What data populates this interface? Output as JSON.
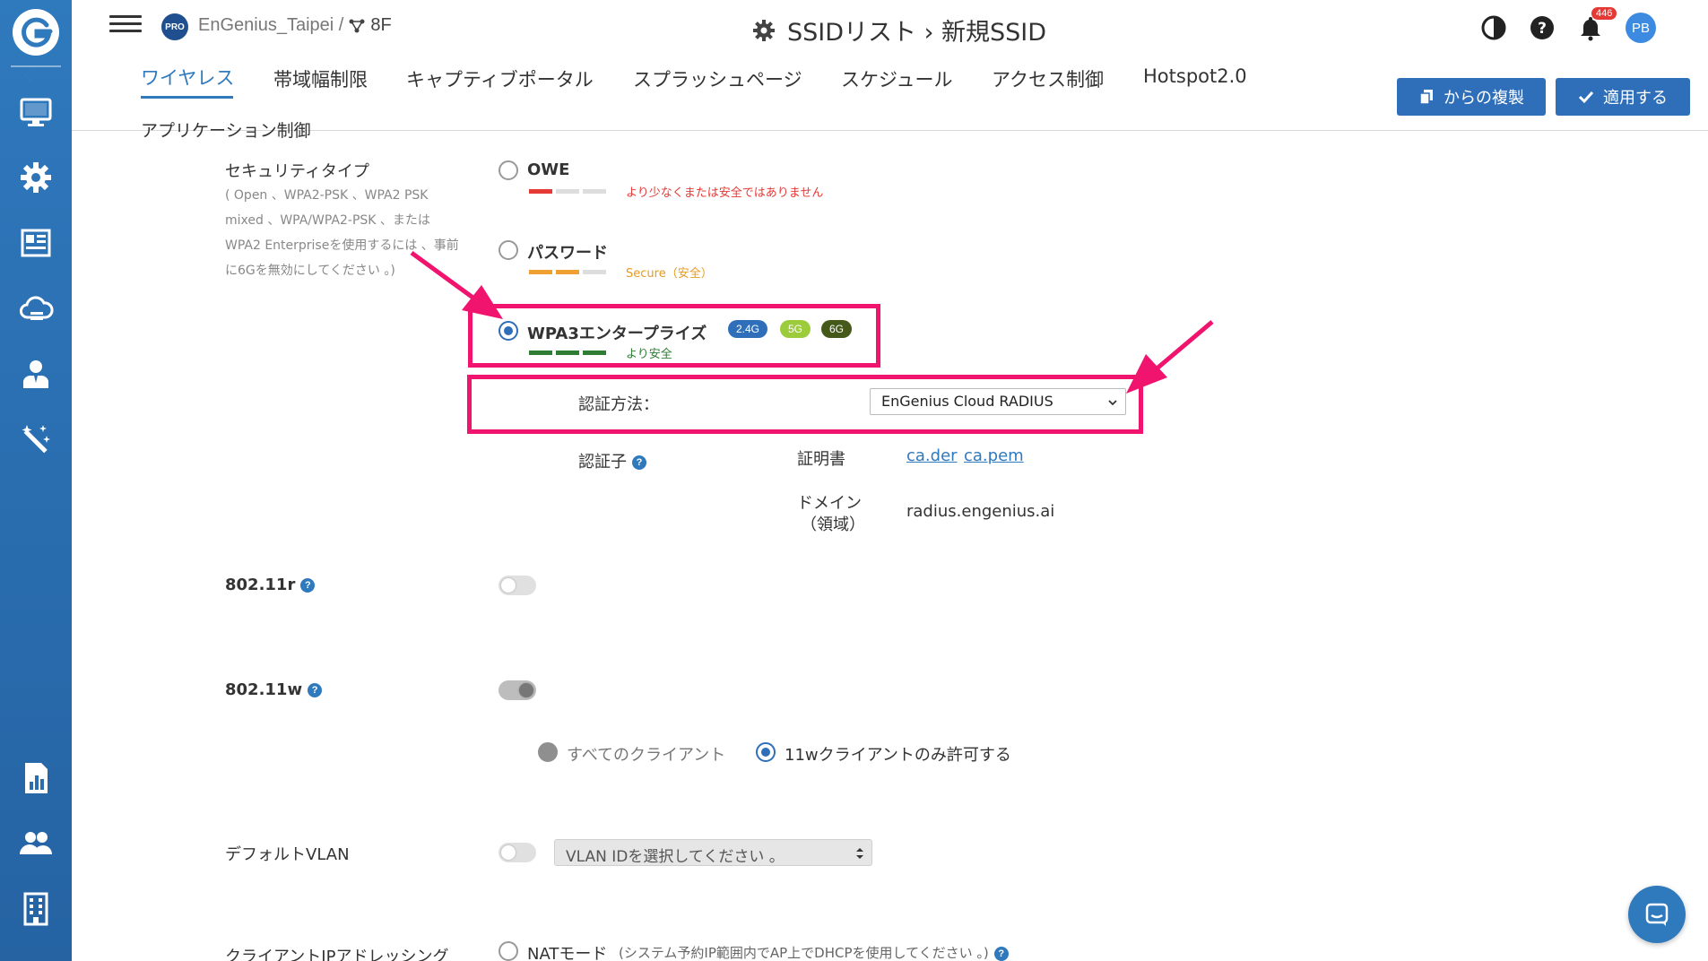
{
  "colors": {
    "brand": "#2f79bd",
    "highlight": "#f0146e",
    "weak": "#e53935",
    "medium": "#f0a030",
    "strong": "#2e7d32"
  },
  "sidebar": {
    "items": [
      "monitor-icon",
      "gear-icon",
      "dashboard-icon",
      "cloud-icon",
      "user-icon",
      "magic-wand-icon",
      "report-icon",
      "team-icon",
      "building-icon"
    ]
  },
  "header": {
    "pro_badge": "PRO",
    "org": "EnGenius_Taipei /",
    "floor": "8F",
    "title": "SSIDリスト › 新規SSID",
    "notification_count": "446",
    "avatar": "PB"
  },
  "tabs": [
    {
      "label": "ワイヤレス",
      "active": true
    },
    {
      "label": "帯域幅制限"
    },
    {
      "label": "キャプティブポータル"
    },
    {
      "label": "スプラッシュページ"
    },
    {
      "label": "スケジュール"
    },
    {
      "label": "アクセス制御"
    },
    {
      "label": "Hotspot2.0"
    },
    {
      "label": "アプリケーション制御"
    }
  ],
  "actions": {
    "copy_from": "からの複製",
    "apply": "適用する"
  },
  "security": {
    "label": "セキュリティタイプ",
    "description": "( Open 、WPA2-PSK 、WPA2 PSK mixed 、WPA/WPA2-PSK 、または WPA2 Enterpriseを使用するには 、事前に6Gを無効にしてください 。)",
    "options": [
      {
        "label": "OWE",
        "strength_text": "より少なくまたは安全ではありません",
        "strength": "weak"
      },
      {
        "label": "パスワード",
        "strength_text": "Secure（安全）",
        "strength": "medium"
      },
      {
        "label": "WPA3エンタープライズ",
        "strength_text": "より安全",
        "strength": "strong",
        "selected": true,
        "bands": [
          "2.4G",
          "5G",
          "6G"
        ]
      }
    ]
  },
  "auth": {
    "method_label": "認証方法：",
    "method_value": "EnGenius Cloud RADIUS",
    "authenticator_label": "認証子",
    "cert_label": "証明書",
    "cert_links": [
      "ca.der",
      "ca.pem"
    ],
    "domain_label_1": "ドメイン",
    "domain_label_2": "（領域）",
    "domain_value": "radius.engenius.ai"
  },
  "dot11r": {
    "label": "802.11r",
    "enabled": false
  },
  "dot11w": {
    "label": "802.11w",
    "options": [
      {
        "label": "すべてのクライアント",
        "selected": false
      },
      {
        "label": "11wクライアントのみ許可する",
        "selected": true
      }
    ]
  },
  "vlan": {
    "label": "デフォルトVLAN",
    "placeholder": "VLAN IDを選択してください 。"
  },
  "client_ip": {
    "label": "クライアントIPアドレッシング",
    "nat_label": "NATモード",
    "nat_note": "(システム予約IP範囲内でAP上でDHCPを使用してください 。)"
  }
}
